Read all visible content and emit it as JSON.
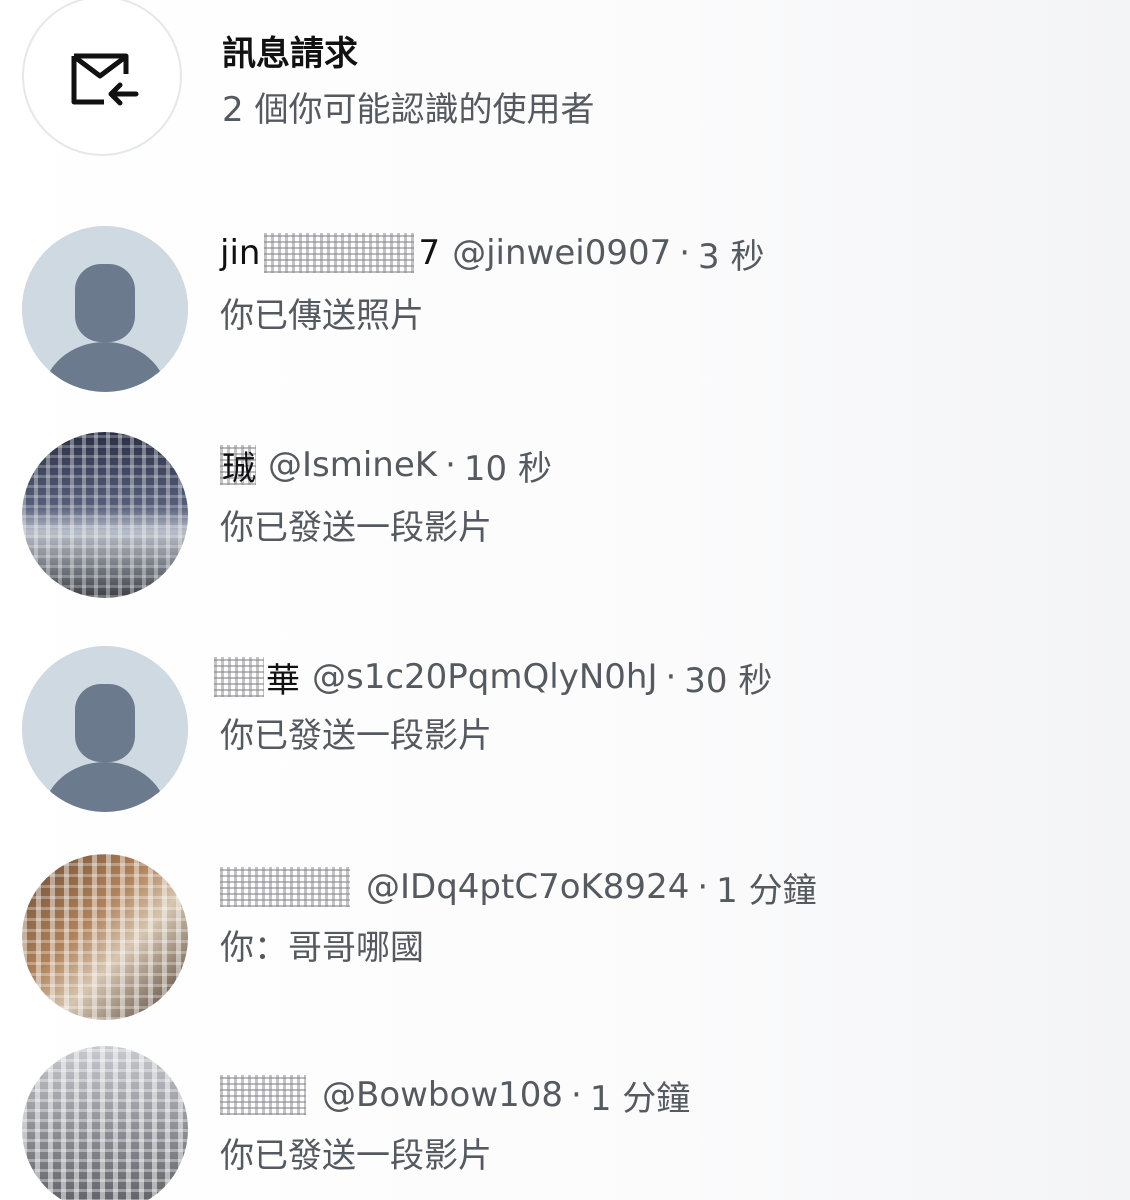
{
  "requests": {
    "title": "訊息請求",
    "subtitle": "2 個你可能認識的使用者",
    "icon": "envelope-incoming-icon"
  },
  "conversations": [
    {
      "name_visible_start": "jin",
      "name_visible_end": "7",
      "handle": "@jinwei0907",
      "time": "3 秒",
      "preview": "你已傳送照片",
      "avatar": "default-avatar-icon"
    },
    {
      "name_visible_start": "",
      "name_visible_end": "珹",
      "handle": "@IsmineK",
      "time": "10 秒",
      "preview": "你已發送一段影片",
      "avatar": "user-photo"
    },
    {
      "name_visible_start": "",
      "name_visible_end": "華",
      "handle": "@s1c20PqmQlyN0hJ",
      "time": "30 秒",
      "preview": "你已發送一段影片",
      "avatar": "default-avatar-icon"
    },
    {
      "name_visible_start": "",
      "name_visible_end": "",
      "handle": "@IDq4ptC7oK8924",
      "time": "1 分鐘",
      "preview": "你：哥哥哪國",
      "avatar": "user-photo"
    },
    {
      "name_visible_start": "",
      "name_visible_end": "",
      "handle": "@Bowbow108",
      "time": "1 分鐘",
      "preview": "你已發送一段影片",
      "avatar": "user-photo"
    }
  ],
  "separator": "·"
}
